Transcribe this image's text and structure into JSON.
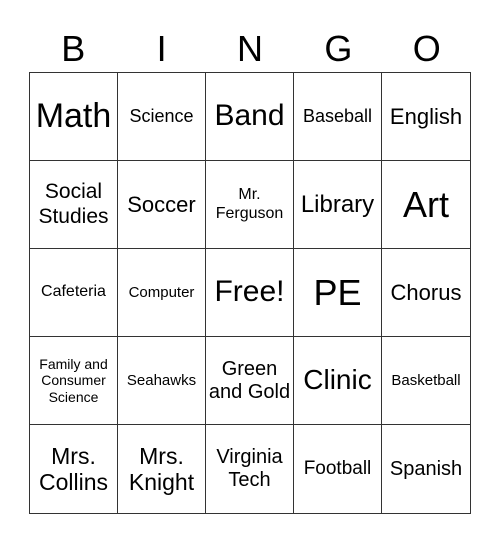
{
  "header": [
    "B",
    "I",
    "N",
    "G",
    "O"
  ],
  "cells": [
    "Math",
    "Science",
    "Band",
    "Baseball",
    "English",
    "Social Studies",
    "Soccer",
    "Mr. Ferguson",
    "Library",
    "Art",
    "Cafeteria",
    "Computer",
    "Free!",
    "PE",
    "Chorus",
    "Family and Consumer Science",
    "Seahawks",
    "Green and Gold",
    "Clinic",
    "Basketball",
    "Mrs. Collins",
    "Mrs. Knight",
    "Virginia Tech",
    "Football",
    "Spanish"
  ]
}
